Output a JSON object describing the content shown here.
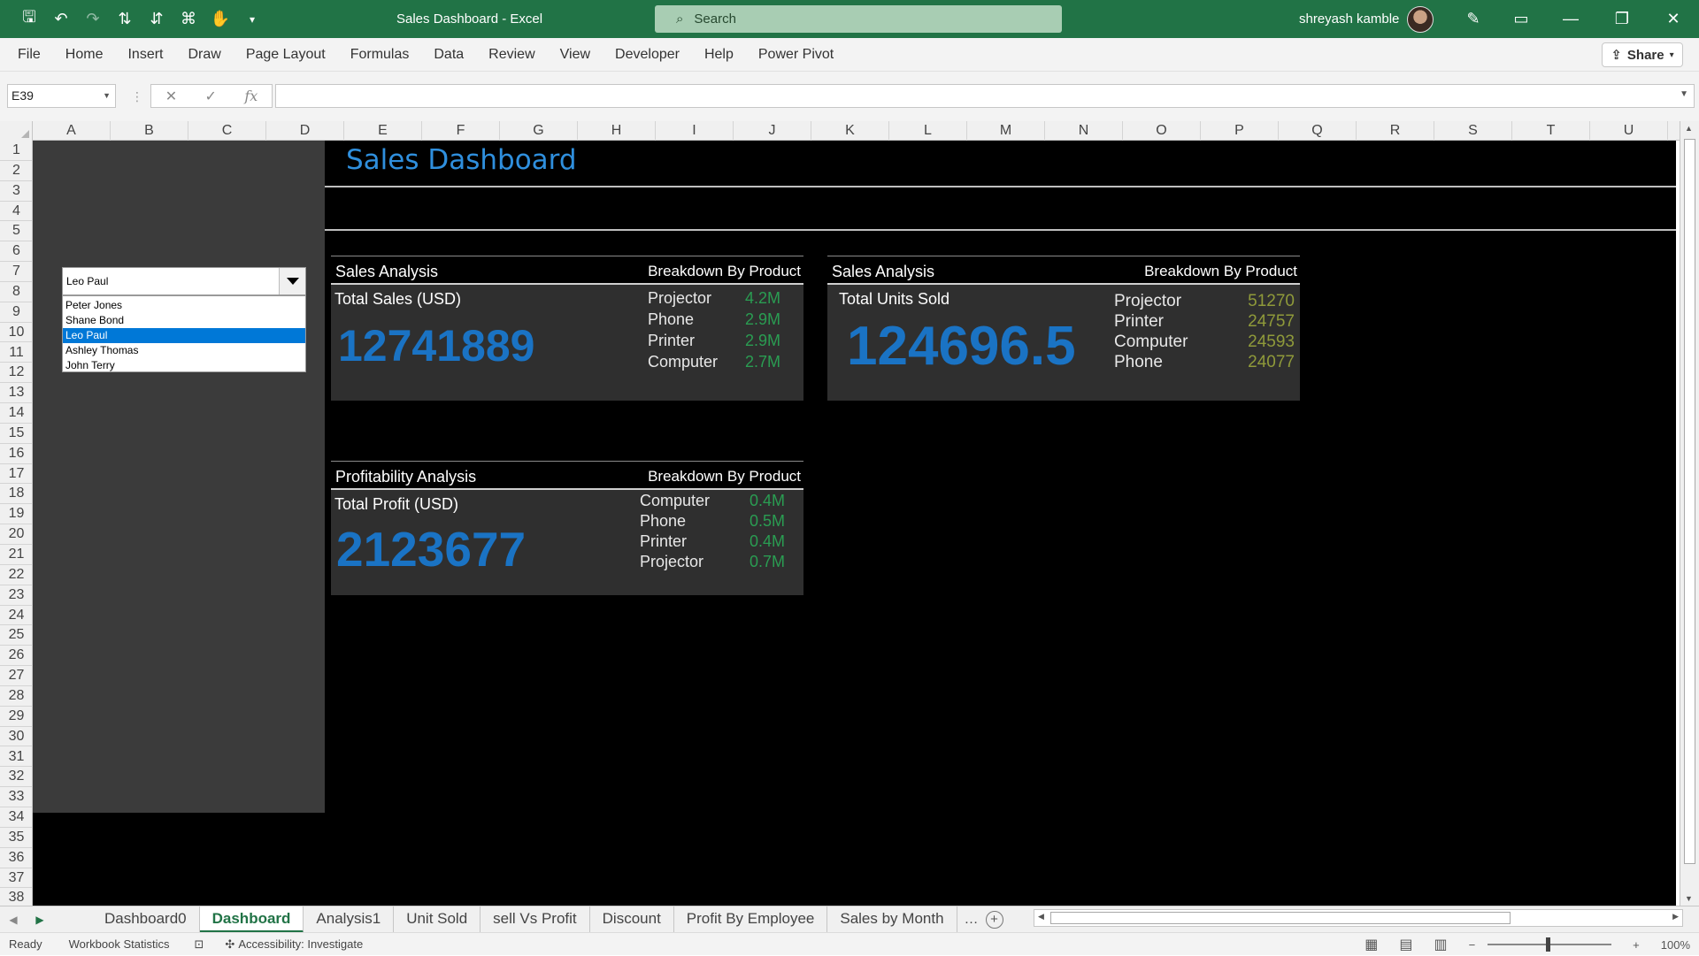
{
  "window": {
    "doc_title": "Sales Dashboard  -  Excel",
    "search_placeholder": "Search",
    "user_name": "shreyash kamble"
  },
  "ribbon": {
    "tabs": [
      "File",
      "Home",
      "Insert",
      "Draw",
      "Page Layout",
      "Formulas",
      "Data",
      "Review",
      "View",
      "Developer",
      "Help",
      "Power Pivot"
    ],
    "share_label": "Share"
  },
  "formula_bar": {
    "name_box": "E39",
    "formula": ""
  },
  "columns": [
    "A",
    "B",
    "C",
    "D",
    "E",
    "F",
    "G",
    "H",
    "I",
    "J",
    "K",
    "L",
    "M",
    "N",
    "O",
    "P",
    "Q",
    "R",
    "S",
    "T",
    "U"
  ],
  "rows": [
    "1",
    "2",
    "3",
    "4",
    "5",
    "6",
    "7",
    "8",
    "9",
    "10",
    "11",
    "12",
    "13",
    "14",
    "15",
    "16",
    "17",
    "18",
    "19",
    "20",
    "21",
    "22",
    "23",
    "24",
    "25",
    "26",
    "27",
    "28",
    "29",
    "30",
    "31",
    "32",
    "33",
    "34",
    "35",
    "36",
    "37",
    "38"
  ],
  "dashboard": {
    "title": "Sales Dashboard",
    "employee_selector": {
      "selected": "Leo Paul",
      "options": [
        "Peter Jones",
        "Shane Bond",
        "Leo Paul",
        "Ashley Thomas",
        "John Terry"
      ]
    },
    "sales_card": {
      "title": "Sales Analysis",
      "breakdown_label": "Breakdown By Product",
      "metric_label": "Total Sales (USD)",
      "metric_value": "12741889",
      "items": [
        {
          "name": "Projector",
          "value": "4.2M"
        },
        {
          "name": "Phone",
          "value": "2.9M"
        },
        {
          "name": "Printer",
          "value": "2.9M"
        },
        {
          "name": "Computer",
          "value": "2.7M"
        }
      ]
    },
    "units_card": {
      "title": "Sales Analysis",
      "breakdown_label": "Breakdown By Product",
      "metric_label": "Total Units Sold",
      "metric_value": "124696.5",
      "items": [
        {
          "name": "Projector",
          "value": "51270"
        },
        {
          "name": "Printer",
          "value": "24757"
        },
        {
          "name": "Computer",
          "value": "24593"
        },
        {
          "name": "Phone",
          "value": "24077"
        }
      ]
    },
    "profit_card": {
      "title": "Profitability Analysis",
      "breakdown_label": "Breakdown By Product",
      "metric_label": "Total Profit (USD)",
      "metric_value": "2123677",
      "items": [
        {
          "name": "Computer",
          "value": "0.4M"
        },
        {
          "name": "Phone",
          "value": "0.5M"
        },
        {
          "name": "Printer",
          "value": "0.4M"
        },
        {
          "name": "Projector",
          "value": "0.7M"
        }
      ]
    }
  },
  "sheet_tabs": [
    "Dashboard0",
    "Dashboard",
    "Analysis1",
    "Unit Sold",
    "sell Vs Profit",
    "Discount",
    "Profit By Employee",
    "Sales by Month"
  ],
  "active_sheet": "Dashboard",
  "status": {
    "ready": "Ready",
    "workbook_stats": "Workbook Statistics",
    "accessibility": "Accessibility: Investigate",
    "zoom": "100%"
  },
  "colors": {
    "excel_green": "#217346",
    "title_blue": "#2f8fdd",
    "metric_blue": "#1a73c4",
    "value_green": "#2a9d52",
    "value_olive": "#8f9a3a",
    "selected_option": "#0078d7"
  }
}
